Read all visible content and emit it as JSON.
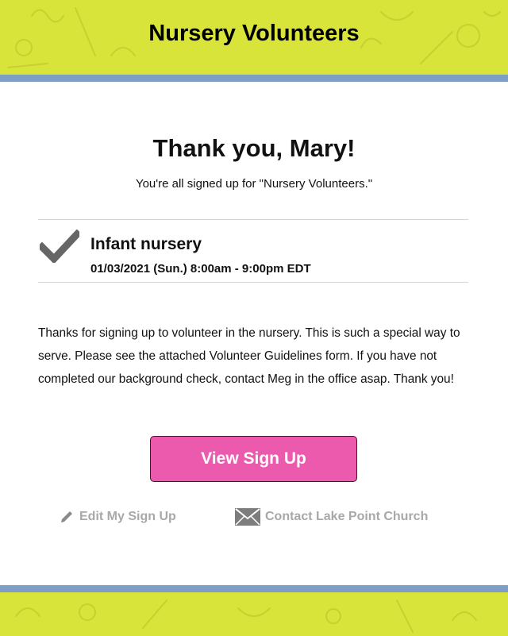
{
  "header": {
    "title": "Nursery Volunteers"
  },
  "confirmation": {
    "title": "Thank you, Mary!",
    "subtitle": "You're all signed up for \"Nursery Volunteers.\""
  },
  "slot": {
    "name": "Infant nursery",
    "time": "01/03/2021 (Sun.) 8:00am - 9:00pm EDT"
  },
  "message": "Thanks for signing up to volunteer in the nursery. This is such a special way to serve. Please see the attached Volunteer Guidelines form. If you have not completed our background check, contact Meg in the office asap. Thank you!",
  "actions": {
    "view_label": "View Sign Up",
    "edit_label": "Edit My Sign Up",
    "contact_label": "Contact Lake Point Church"
  },
  "colors": {
    "banner": "#d9e43a",
    "stripe": "#7f9ec6",
    "button": "#ec5aae",
    "link": "#a8a8a8"
  }
}
